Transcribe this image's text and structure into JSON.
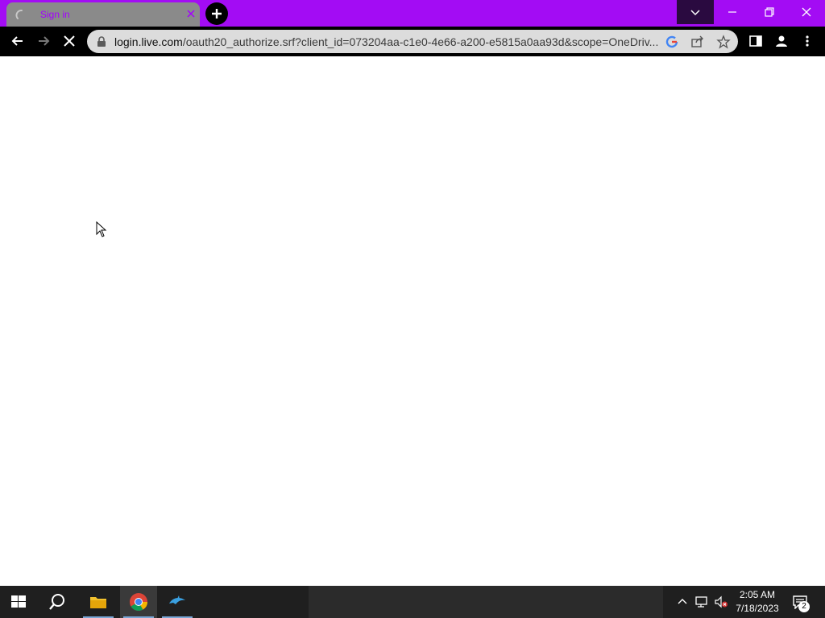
{
  "browser": {
    "tab": {
      "title": "Sign in",
      "icon": "loading-spinner-icon"
    },
    "new_tab_icon": "plus-icon",
    "window_controls": [
      "chevron-down-icon",
      "minimize-icon",
      "restore-icon",
      "close-icon"
    ],
    "toolbar": {
      "back_icon": "arrow-left-icon",
      "forward_icon": "arrow-right-icon",
      "stop_icon": "close-icon",
      "url_host": "login.live.com",
      "url_rest": "/oauth20_authorize.srf?client_id=073204aa-c1e0-4e66-a200-e5815a0aa93d&scope=OneDriv...",
      "omnibox_icons": [
        "google-lens-icon",
        "share-icon",
        "star-icon"
      ],
      "right_icons": [
        "side-panel-icon",
        "profile-icon",
        "more-vert-icon"
      ]
    },
    "accent_color": "#a30cf4"
  },
  "taskbar": {
    "apps": [
      "windows-start-icon",
      "search-icon",
      "file-explorer-icon",
      "chrome-icon",
      "dolphin-icon"
    ],
    "tray_icons": [
      "chevron-up-icon",
      "network-icon",
      "volume-muted-icon"
    ],
    "time": "2:05 AM",
    "date": "7/18/2023",
    "notification_count": "2"
  }
}
